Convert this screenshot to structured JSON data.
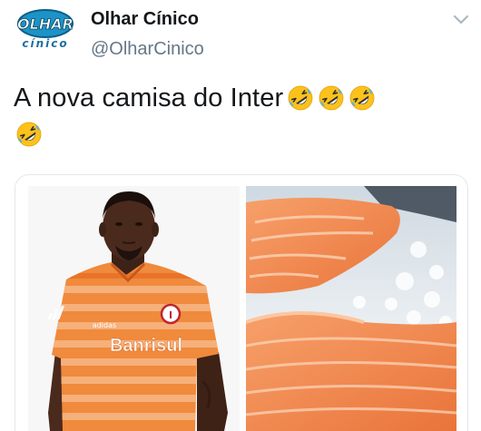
{
  "author": {
    "name": "Olhar Cínico",
    "handle": "@OlharCinico",
    "avatar_logo_top": "OLHAR",
    "avatar_logo_bottom": "cínico"
  },
  "tweet": {
    "text": "A nova camisa do Inter",
    "emoji_name": "rolling-on-the-floor-laughing",
    "emoji_count": 4
  },
  "media": {
    "left_image": {
      "subject": "player-in-striped-orange-jersey",
      "shirt_brand": "adidas",
      "shirt_sponsor": "Banrisul"
    },
    "right_image": {
      "subject": "salmon-fillets-on-ice"
    }
  },
  "colors": {
    "name_text": "#14171a",
    "handle_text": "#657786",
    "border": "#e1e8ed",
    "jersey_orange": "#f08a3c",
    "jersey_stripe": "#f6b07a",
    "salmon": "#f0894f",
    "emoji_yellow": "#fcc21b"
  }
}
